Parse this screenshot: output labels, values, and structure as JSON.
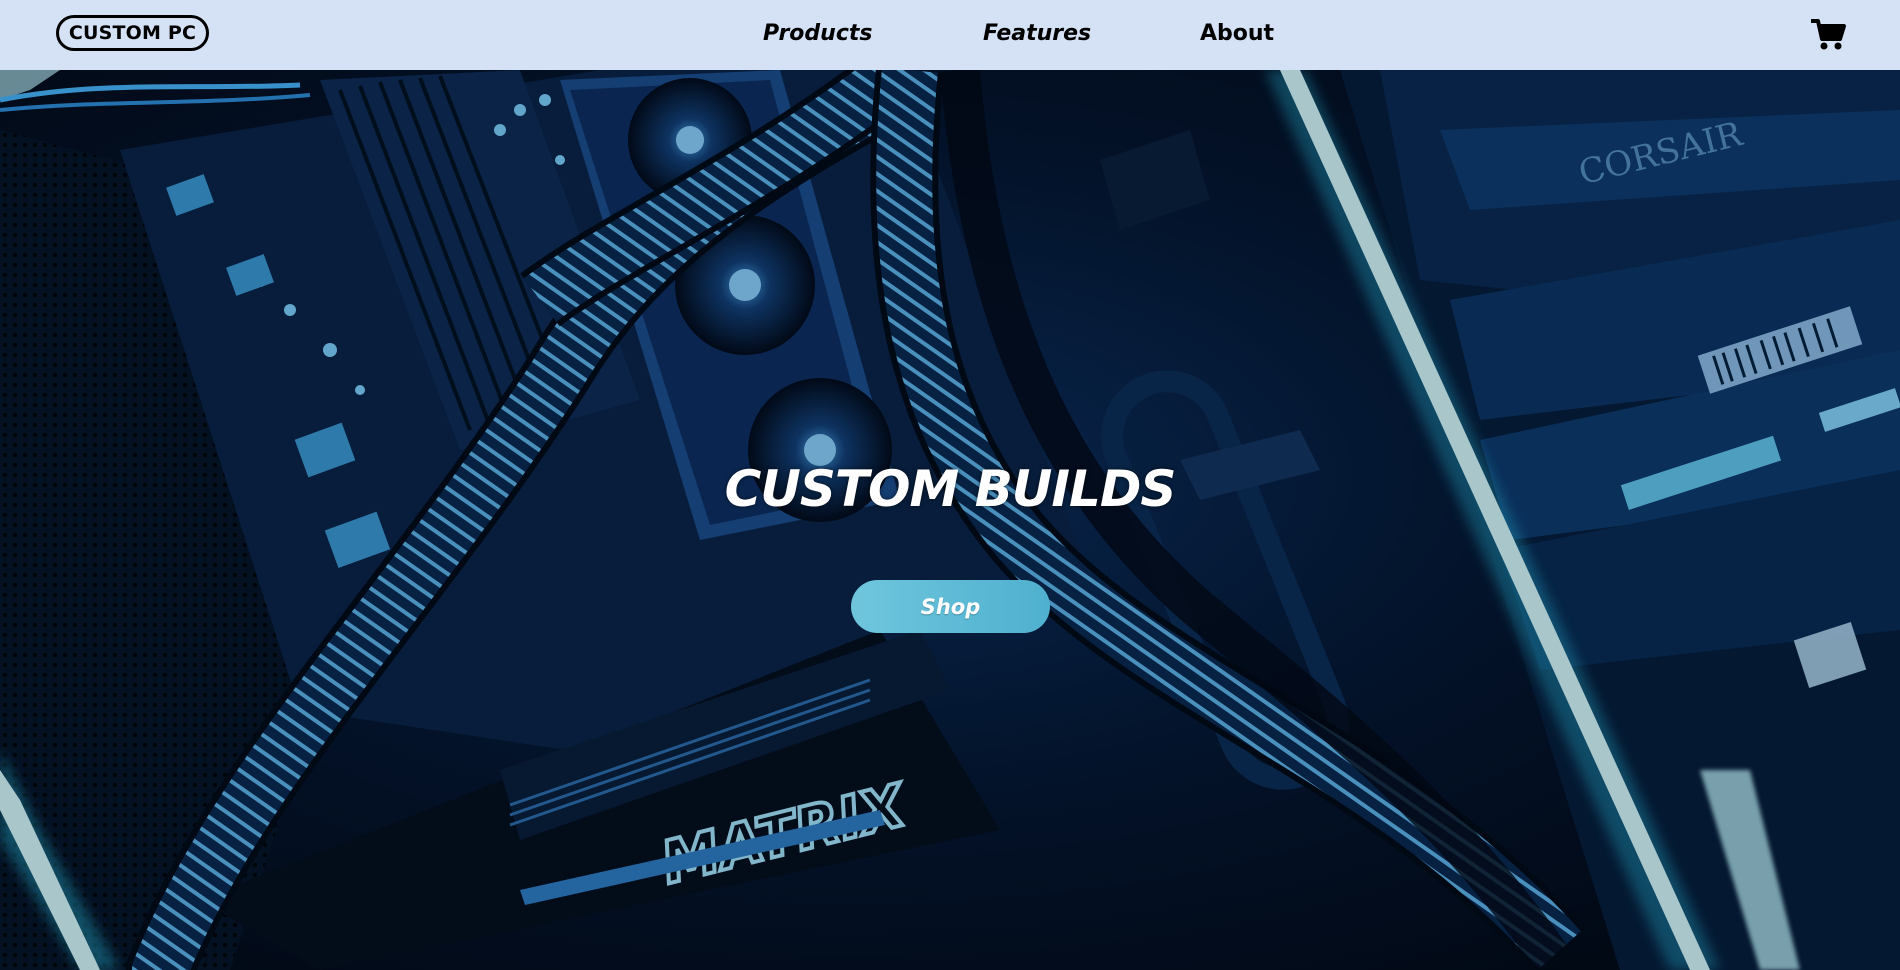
{
  "header": {
    "brand": "CUSTOM PC",
    "nav": {
      "products": "Products",
      "features": "Features",
      "about": "About"
    },
    "cart_icon": "shopping-cart-icon"
  },
  "hero": {
    "background": "illuminated-pc-internals-photo",
    "title": "CUSTOM BUILDS",
    "shop_button": "Shop"
  },
  "colors": {
    "header_bg": "#d5e1f4",
    "accent_button": "#5ab8d4",
    "glow": "#3fe0ff"
  }
}
